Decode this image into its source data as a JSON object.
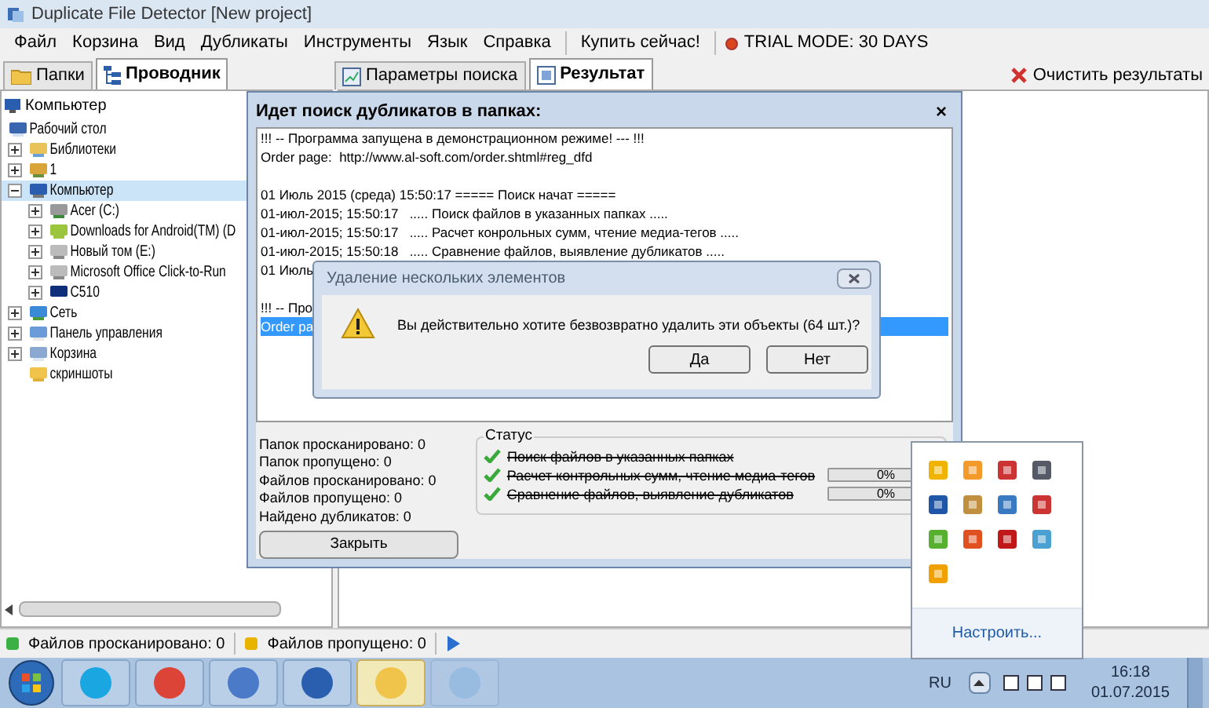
{
  "window": {
    "title": "Duplicate File Detector [New project]"
  },
  "menu": [
    {
      "label": "Файл",
      "kind": "item"
    },
    {
      "label": "Корзина",
      "kind": "item"
    },
    {
      "label": "Вид",
      "kind": "item"
    },
    {
      "label": "Дубликаты",
      "kind": "item"
    },
    {
      "label": "Инструменты",
      "kind": "item"
    },
    {
      "label": "Язык",
      "kind": "item"
    },
    {
      "label": "Справка",
      "kind": "item"
    },
    {
      "label": "Купить сейчас!",
      "kind": "separated"
    },
    {
      "label": "TRIAL MODE: 30 DAYS",
      "kind": "trial"
    }
  ],
  "left_tabs": [
    {
      "label": "Папки",
      "selected": false
    },
    {
      "label": "Проводник",
      "selected": true
    }
  ],
  "right_tabs": [
    {
      "label": "Параметры поиска",
      "selected": false
    },
    {
      "label": "Результат",
      "selected": true
    }
  ],
  "clear_button": "Очистить результаты",
  "tree_header": "Компьютер",
  "tree": [
    {
      "label": "Рабочий стол",
      "selected": false,
      "children": [
        {
          "label": "Библиотеки",
          "expanded": false,
          "selected": false
        },
        {
          "label": "1",
          "expanded": false,
          "selected": false
        },
        {
          "label": "Компьютер",
          "expanded": true,
          "selected": true,
          "children": [
            {
              "label": "Acer (C:)",
              "expanded": false,
              "selected": false
            },
            {
              "label": "Downloads for Android(TM) (D",
              "expanded": false,
              "selected": false
            },
            {
              "label": "Новый том (E:)",
              "expanded": false,
              "selected": false
            },
            {
              "label": "Microsoft Office Click-to-Run",
              "expanded": false,
              "selected": false
            },
            {
              "label": "C510",
              "expanded": false,
              "selected": false
            }
          ]
        },
        {
          "label": "Сеть",
          "expanded": false,
          "selected": false
        },
        {
          "label": "Панель управления",
          "expanded": false,
          "selected": false
        },
        {
          "label": "Корзина",
          "expanded": false,
          "selected": false
        },
        {
          "label": "скриншоты",
          "selected": false
        }
      ]
    }
  ],
  "search_dialog": {
    "title": "Идет поиск дубликатов в папках:",
    "close": "×",
    "log": [
      {
        "lines": [
          {
            "text": "!!! -- Программа запущена в демонстрационном режиме! --- !!!",
            "selected": false
          },
          {
            "text": "Order page:  http://www.al-soft.com/order.shtml#reg_dfd",
            "selected": false
          }
        ]
      },
      {
        "lines": [
          {
            "text": "01 Июль 2015 (среда) 15:50:17 ===== Поиск начат =====",
            "selected": false
          },
          {
            "text": "01-июл-2015; 15:50:17   ..... Поиск файлов в указанных папках .....",
            "selected": false
          },
          {
            "text": "01-июл-2015; 15:50:17   ..... Расчет конрольных сумм, чтение медиа-тегов .....",
            "selected": false
          },
          {
            "text": "01-июл-2015; 15:50:18   ..... Сравнение файлов, выявление дубликатов .....",
            "selected": false
          },
          {
            "text": "01 Июль",
            "selected": false
          }
        ]
      },
      {
        "lines": [
          {
            "text": "!!! -- Про",
            "selected": false
          },
          {
            "text": "Order pa",
            "selected": true
          }
        ]
      }
    ],
    "stats": [
      "Папок просканировано: 0",
      "Папок пропущено: 0",
      "Файлов просканировано: 0",
      "Файлов пропущено: 0",
      "Найдено дубликатов: 0"
    ],
    "status_title": "Статус",
    "steps": [
      {
        "text": "Поиск файлов в указанных папках",
        "done": true
      },
      {
        "text": "Расчет контрольных сумм, чтение медиа-тегов",
        "done": true,
        "progress": {
          "level": 0,
          "reading": "0%"
        }
      },
      {
        "text": "Сравнение файлов, выявление дубликатов",
        "done": true,
        "progress": {
          "level": 0,
          "reading": "0%"
        }
      }
    ],
    "close_button": "Закрыть"
  },
  "confirm_dialog": {
    "title": "Удаление нескольких элементов",
    "message": "Вы действительно хотите безвозвратно удалить эти объекты (64 шт.)?",
    "buttons": [
      "Да",
      "Нет"
    ]
  },
  "status_bar": [
    {
      "text": "Файлов просканировано: 0",
      "color": "#3cb043"
    },
    {
      "text": "Файлов пропущено: 0",
      "color": "#e8b400"
    }
  ],
  "tray_popup": {
    "link": "Настроить..."
  },
  "taskbar": {
    "apps": [
      {
        "active": false,
        "dimmed": false
      },
      {
        "active": false,
        "dimmed": false
      },
      {
        "active": false,
        "dimmed": false
      },
      {
        "active": false,
        "dimmed": false
      },
      {
        "active": true,
        "dimmed": false
      },
      {
        "active": false,
        "dimmed": true
      }
    ],
    "language": "RU",
    "time": "16:18",
    "date": "01.07.2015"
  }
}
